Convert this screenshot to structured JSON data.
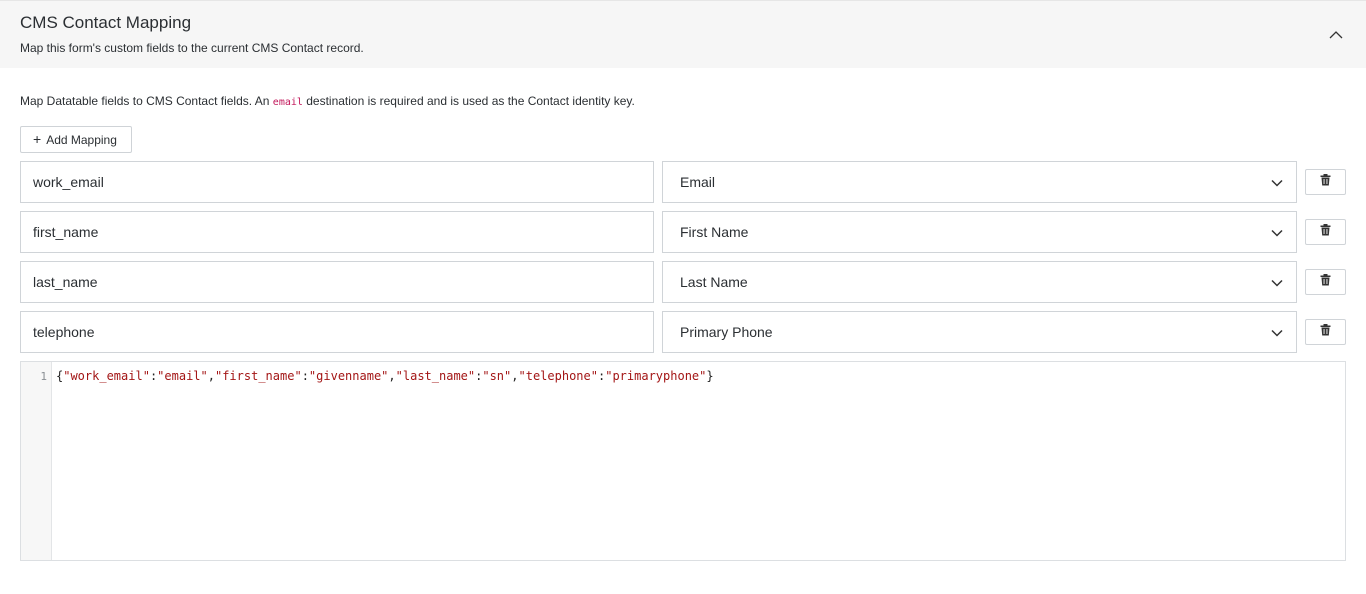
{
  "header": {
    "title": "CMS Contact Mapping",
    "subtitle": "Map this form's custom fields to the current CMS Contact record."
  },
  "help": {
    "before": "Map Datatable fields to CMS Contact fields. An ",
    "code": "email",
    "after": " destination is required and is used as the Contact identity key."
  },
  "toolbar": {
    "add_label": "Add Mapping"
  },
  "mappings": [
    {
      "source": "work_email",
      "destination": "Email"
    },
    {
      "source": "first_name",
      "destination": "First Name"
    },
    {
      "source": "last_name",
      "destination": "Last Name"
    },
    {
      "source": "telephone",
      "destination": "Primary Phone"
    }
  ],
  "editor": {
    "line_number": "1",
    "pairs": [
      {
        "key": "\"work_email\"",
        "value": "\"email\""
      },
      {
        "key": "\"first_name\"",
        "value": "\"givenname\""
      },
      {
        "key": "\"last_name\"",
        "value": "\"sn\""
      },
      {
        "key": "\"telephone\"",
        "value": "\"primaryphone\""
      }
    ]
  },
  "icons": {
    "collapse": "chevron-up-icon",
    "dropdown": "chevron-down-icon",
    "delete": "trash-icon",
    "add": "plus-icon"
  },
  "colors": {
    "header_bg": "#f6f6f6",
    "string": "#a31515",
    "code_keyword": "#c2185b"
  }
}
